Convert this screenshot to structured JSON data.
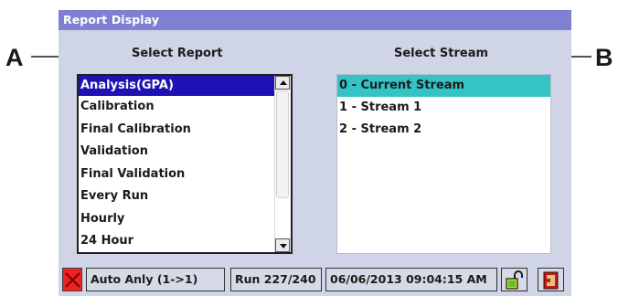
{
  "callouts": {
    "a": "A",
    "b": "B"
  },
  "window": {
    "title": "Report Display"
  },
  "labels": {
    "select_report": "Select Report",
    "select_stream": "Select Stream"
  },
  "reports": {
    "items": [
      "Analysis(GPA)",
      "Calibration",
      "Final Calibration",
      "Validation",
      "Final Validation",
      "Every Run",
      "Hourly",
      "24 Hour"
    ],
    "selected": "Analysis(GPA)"
  },
  "streams": {
    "items": [
      "0 - Current Stream",
      "1 - Stream 1",
      "2 - Stream 2"
    ],
    "selected": "0 - Current Stream"
  },
  "status": {
    "mode": "Auto Anly (1->1)",
    "run": "Run 227/240",
    "datetime": "06/06/2013 09:04:15 AM"
  },
  "icons": {
    "alarm": "alarm-x-icon",
    "lock": "unlock-padlock-icon",
    "exit": "exit-door-icon"
  },
  "colors": {
    "titlebar": "#7f80d2",
    "window_bg": "#cfd4e6",
    "report_selected": "#1e12b4",
    "stream_selected": "#34c4c6",
    "alarm": "#ee2222"
  }
}
